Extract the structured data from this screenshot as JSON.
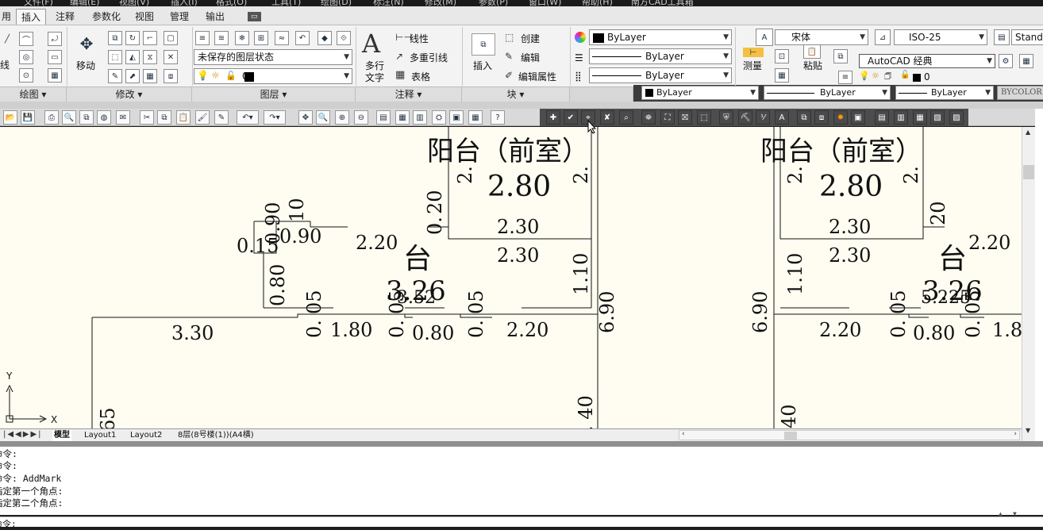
{
  "menubar": {
    "items": [
      "文件(F)",
      "编辑(E)",
      "视图(V)",
      "插入(I)",
      "格式(O)",
      "工具(T)",
      "绘图(D)",
      "标注(N)",
      "修改(M)",
      "参数(P)",
      "窗口(W)",
      "帮助(H)",
      "南方CAD工具箱"
    ]
  },
  "ribbon_tabs": [
    "用",
    "插入",
    "注释",
    "参数化",
    "视图",
    "管理",
    "输出"
  ],
  "ribbon": {
    "draw_left": "线",
    "move_label": "移动",
    "layer_state": "未保存的图层状态",
    "layer_current": "0",
    "linear_label": "线性",
    "multileader_label": "多重引线",
    "table_label": "表格",
    "mtext_label_1": "多行",
    "mtext_label_2": "文字",
    "insert_label": "插入",
    "create_label": "创建",
    "edit_label": "编辑",
    "edit_attr_label": "编辑属性",
    "color_value": "ByLayer",
    "linetype_value": "ByLayer",
    "lineweight_value": "ByLayer",
    "font_value": "宋体",
    "dimstyle_value": "ISO-25",
    "tablestyle_value": "Standa",
    "measure_label": "测量",
    "paste_label": "粘贴",
    "workspace_value": "AutoCAD 经典",
    "layer2_value": "0",
    "prop_color": "ByLayer",
    "prop_linetype": "ByLayer",
    "prop_lineweight": "ByLayer",
    "prop_plotstyle": "BYCOLOR",
    "panels": {
      "draw": "绘图",
      "modify": "修改",
      "layer": "图层",
      "annotation": "注释",
      "block": "块"
    }
  },
  "drawing": {
    "labels": {
      "balcony_front": "阳台（前室）",
      "tai": "台",
      "v_2_80": "2.80",
      "v_2_30": "2.30",
      "v_2_20": "2.20",
      "v_3_26": "3.26",
      "v_3_30": "3.30",
      "v_1_80": "1.80",
      "v_0_80": "0.80",
      "v_6_90": "6.90",
      "v_1_10": "1.10",
      "v_0_15": "0.15",
      "v_0_90": "0.90",
      "v_0_80v": "0.80",
      "v_10": "10",
      "v_20": "20",
      "v_05": "05",
      "v_0dot": "0.",
      "v_2dot": "2.",
      "v_40": "40",
      "v_dot40": ". 40",
      "v_65": "65",
      "v_1_8": "1.8",
      "v_3_52": "3.52",
      "v_5_225": "5.225",
      "axis_x": "X",
      "axis_y": "Y"
    }
  },
  "layout_tabs": [
    "模型",
    "Layout1",
    "Layout2",
    "8层(8号楼(1))(A4横)"
  ],
  "command": {
    "history": [
      "命令:",
      "命令:",
      "命令: AddMark",
      "指定第一个角点:",
      "指定第二个角点:"
    ],
    "prompt": "命令:"
  }
}
